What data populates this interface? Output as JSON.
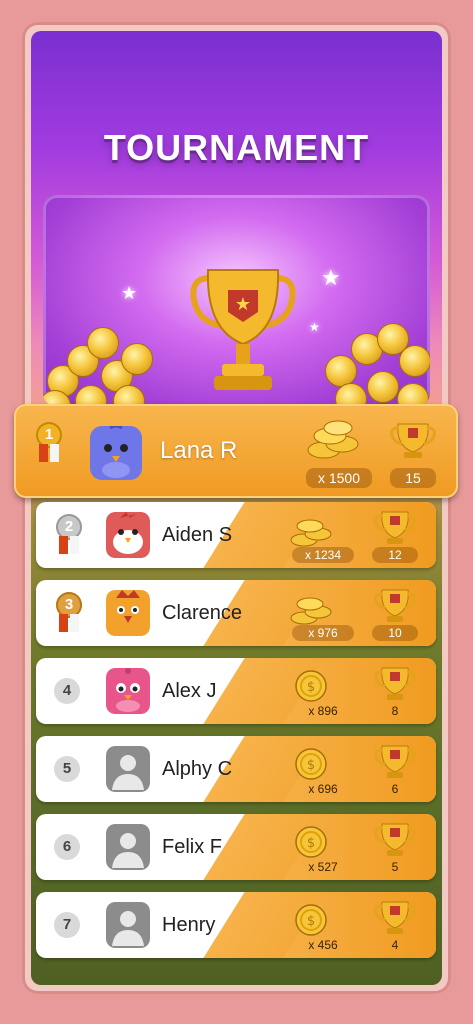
{
  "title": "TOURNAMENT",
  "colors": {
    "accent": "#f09b20",
    "frame": "#e89a9a",
    "gold": "#f5c53a",
    "silver": "#c8c8c8",
    "bronze": "#e0a040",
    "text": "#222222"
  },
  "leader": {
    "rank": "1",
    "name": "Lana R",
    "coins": "x 1500",
    "trophies": "15",
    "avatar": "purple-bird-avatar"
  },
  "rows": [
    {
      "rank": "2",
      "name": "Aiden S",
      "coins": "x 1234",
      "trophies": "12",
      "avatar": "red-bird-avatar"
    },
    {
      "rank": "3",
      "name": "Clarence",
      "coins": "x 976",
      "trophies": "10",
      "avatar": "orange-bird-avatar"
    },
    {
      "rank": "4",
      "name": "Alex J",
      "coins": "x 896",
      "trophies": "8",
      "avatar": "pink-bird-avatar"
    },
    {
      "rank": "5",
      "name": "Alphy C",
      "coins": "x 696",
      "trophies": "6",
      "avatar": "default-avatar"
    },
    {
      "rank": "6",
      "name": "Felix F",
      "coins": "x 527",
      "trophies": "5",
      "avatar": "default-avatar"
    },
    {
      "rank": "7",
      "name": "Henry",
      "coins": "x 456",
      "trophies": "4",
      "avatar": "default-avatar"
    }
  ]
}
